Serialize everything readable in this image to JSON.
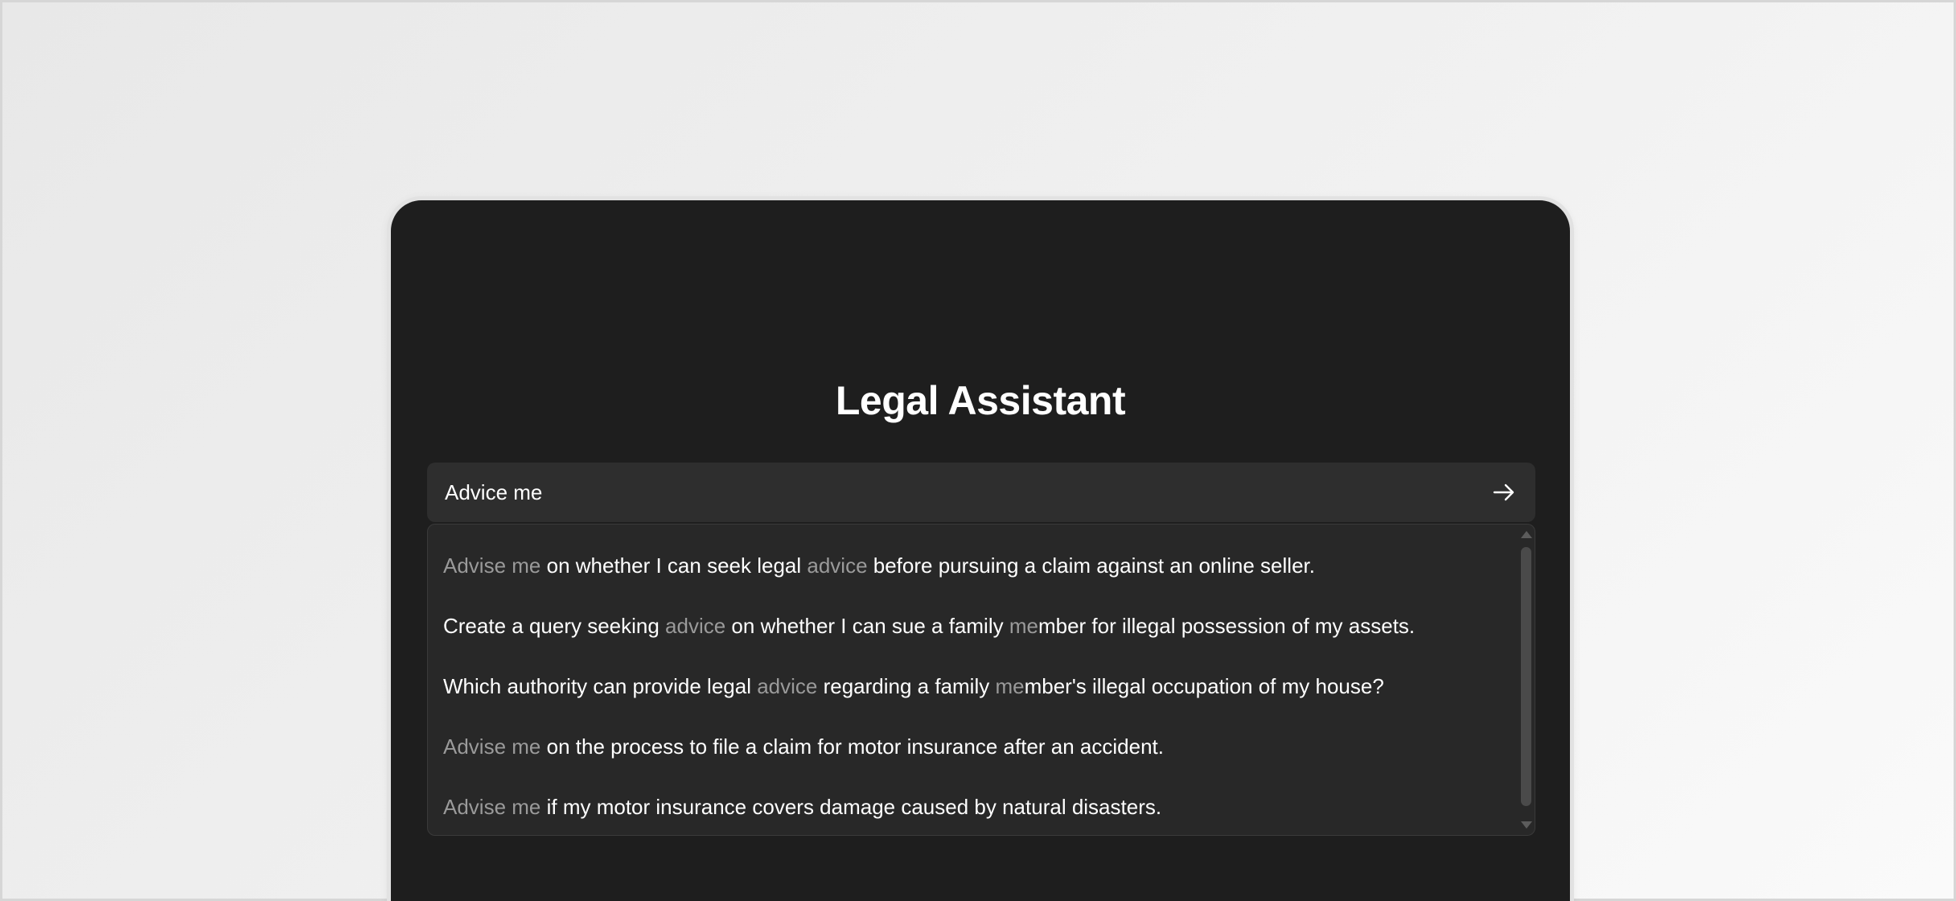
{
  "app": {
    "title": "Legal Assistant"
  },
  "search": {
    "value": "Advice me",
    "submit_icon": "arrow-right-icon"
  },
  "suggestions": [
    [
      {
        "text": "Advise me",
        "muted": true
      },
      {
        "text": " on whether I can seek legal ",
        "muted": false
      },
      {
        "text": "advice",
        "muted": true
      },
      {
        "text": " before pursuing a claim against an online seller.",
        "muted": false
      }
    ],
    [
      {
        "text": "Create a query seeking ",
        "muted": false
      },
      {
        "text": "advice",
        "muted": true
      },
      {
        "text": " on whether I can sue a family ",
        "muted": false
      },
      {
        "text": "me",
        "muted": true
      },
      {
        "text": "mber for illegal possession of my assets.",
        "muted": false
      }
    ],
    [
      {
        "text": "Which authority can provide legal ",
        "muted": false
      },
      {
        "text": "advice",
        "muted": true
      },
      {
        "text": " regarding a family ",
        "muted": false
      },
      {
        "text": "me",
        "muted": true
      },
      {
        "text": "mber's illegal occupation of my house?",
        "muted": false
      }
    ],
    [
      {
        "text": "Advise me",
        "muted": true
      },
      {
        "text": " on the process to file a claim for motor insurance after an accident.",
        "muted": false
      }
    ],
    [
      {
        "text": "Advise me",
        "muted": true
      },
      {
        "text": " if my motor insurance covers damage caused by natural disasters.",
        "muted": false
      }
    ]
  ],
  "colors": {
    "panel_background": "#1e1e1e",
    "input_background": "#2e2e2e",
    "dropdown_background": "#282828",
    "text_primary": "#ffffff",
    "text_muted": "#9a9a9a"
  }
}
